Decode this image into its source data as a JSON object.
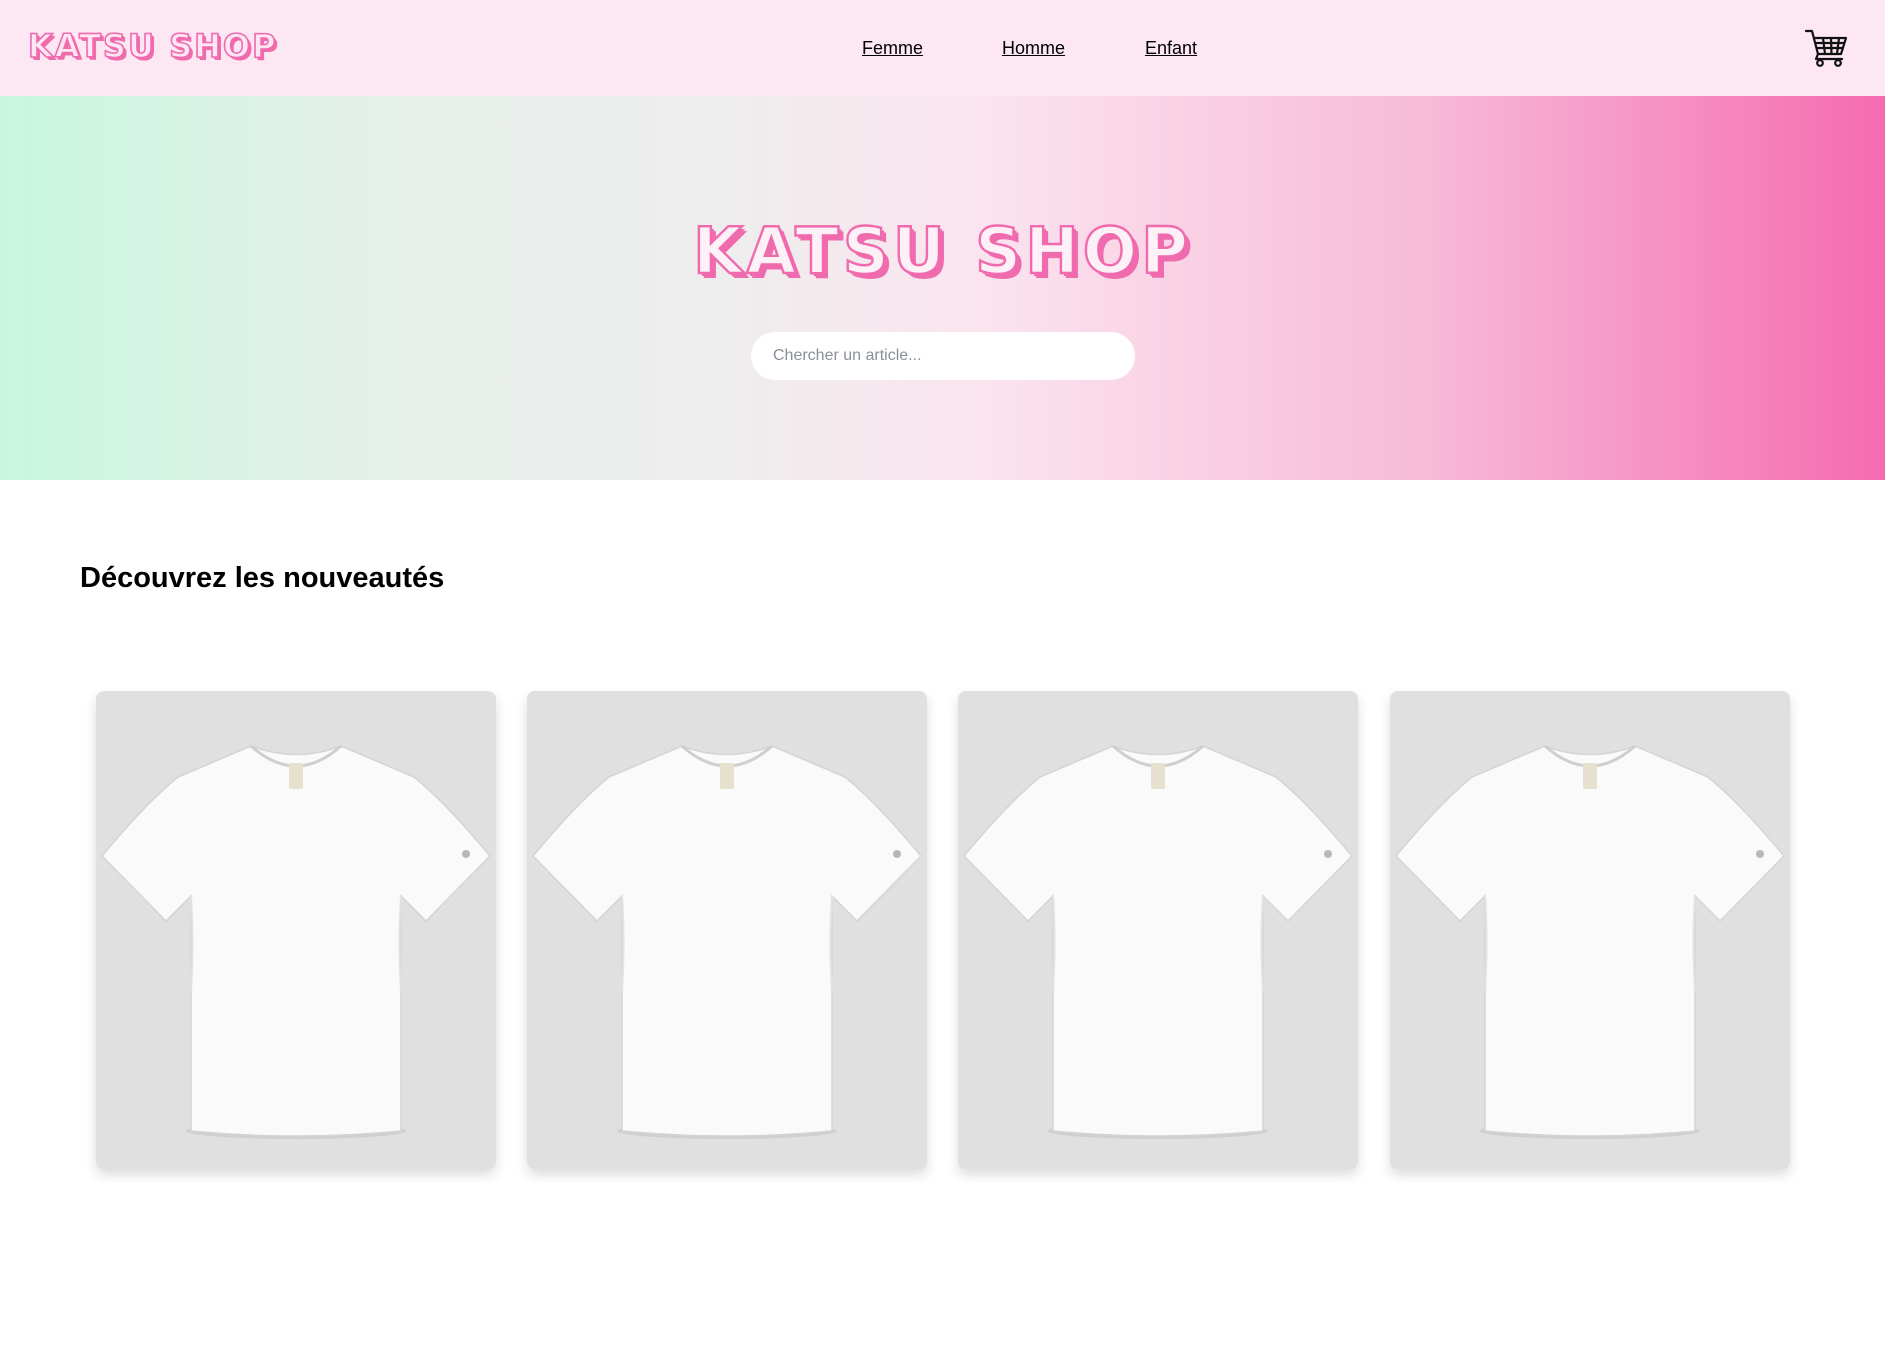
{
  "header": {
    "brand": "KATSU SHOP",
    "nav": [
      {
        "label": "Femme"
      },
      {
        "label": "Homme"
      },
      {
        "label": "Enfant"
      }
    ],
    "cart_icon": "shopping-cart-icon"
  },
  "hero": {
    "title": "KATSU SHOP",
    "search_placeholder": "Chercher un article..."
  },
  "section": {
    "title": "Découvrez les nouveautés",
    "products": [
      {
        "image": "white-tshirt"
      },
      {
        "image": "white-tshirt"
      },
      {
        "image": "white-tshirt"
      },
      {
        "image": "white-tshirt"
      }
    ]
  },
  "colors": {
    "accent_pink": "#f06aae",
    "header_bg": "#fde7f2",
    "gradient_start": "#c8f7e0",
    "gradient_end": "#f56bb1",
    "card_bg": "#e0e0e0"
  }
}
